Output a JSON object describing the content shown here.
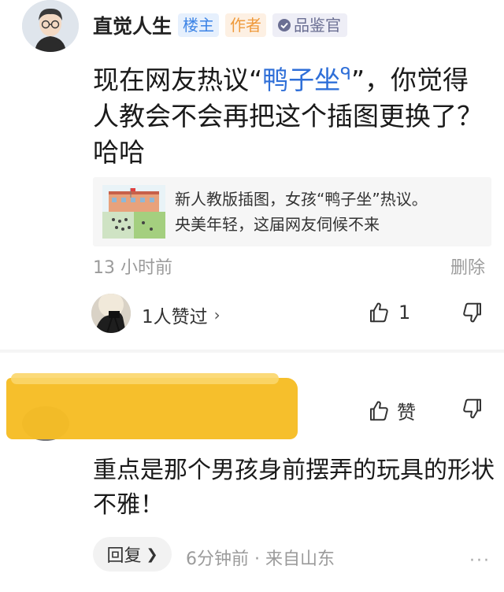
{
  "post": {
    "author": "直觉人生",
    "badges": {
      "owner": "楼主",
      "writer": "作者",
      "judge": "品鉴官"
    },
    "content_before": "现在网友热议“",
    "content_link": "鸭子坐",
    "content_after": "”，你觉得人教会不会再把这个插图更换了？哈哈",
    "link_card": {
      "line1": "新人教版插图，女孩“鸭子坐”热议。",
      "line2": "央美年轻，这届网友伺候不来"
    },
    "time": "13 小时前",
    "delete_label": "删除",
    "likes_summary": "1人赞过",
    "like_count": "1"
  },
  "reply": {
    "like_label": "赞",
    "content": "重点是那个男孩身前摆弄的玩具的形状不雅！",
    "reply_button": "回复",
    "meta": "6分钟前 · 来自山东",
    "more": "···"
  },
  "colors": {
    "accent": "#2f6fd8",
    "highlighter": "#f6bd25",
    "muted": "#9b9b9b"
  },
  "icons": [
    "avatar",
    "search-icon",
    "thumb-up-icon",
    "thumb-down-icon",
    "verified-icon",
    "chevron-right-icon"
  ]
}
